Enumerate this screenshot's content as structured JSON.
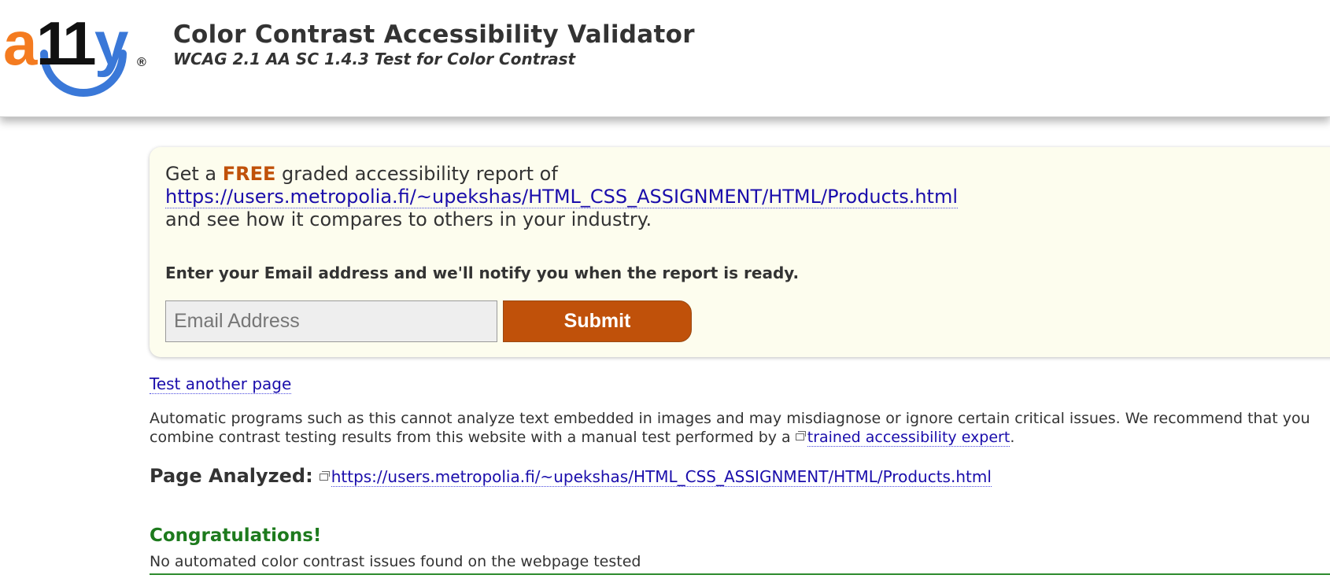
{
  "header": {
    "logo_text": "a11y",
    "logo_mark": "®",
    "title": "Color Contrast Accessibility Validator",
    "subtitle": "WCAG 2.1 AA SC 1.4.3 Test for Color Contrast"
  },
  "promo": {
    "line1_before": "Get a ",
    "free": "FREE",
    "line1_after": " graded accessibility report of",
    "url": "https://users.metropolia.fi/~upekshas/HTML_CSS_ASSIGNMENT/HTML/Products.html",
    "line3": "and see how it compares to others in your industry.",
    "instruction": "Enter your Email address and we'll notify you when the report is ready.",
    "email_placeholder": "Email Address",
    "email_value": "",
    "submit_label": "Submit"
  },
  "test_another": "Test another page",
  "disclaimer": {
    "text": "Automatic programs such as this cannot analyze text embedded in images and may misdiagnose or ignore certain critical issues. We recommend that you combine contrast testing results from this website with a manual test performed by a ",
    "link": "trained accessibility expert",
    "end": "."
  },
  "analyzed": {
    "label": "Page Analyzed:",
    "url": "https://users.metropolia.fi/~upekshas/HTML_CSS_ASSIGNMENT/HTML/Products.html"
  },
  "result": {
    "heading": "Congratulations!",
    "message": "No automated color contrast issues found on the webpage tested"
  },
  "colors": {
    "accent_orange": "#c0510a",
    "logo_blue": "#3a78d8",
    "link_blue": "#1a0dab",
    "success_green": "#1d7a1d",
    "promo_bg": "#fdfdee"
  },
  "icons": [
    "external-link-icon"
  ]
}
